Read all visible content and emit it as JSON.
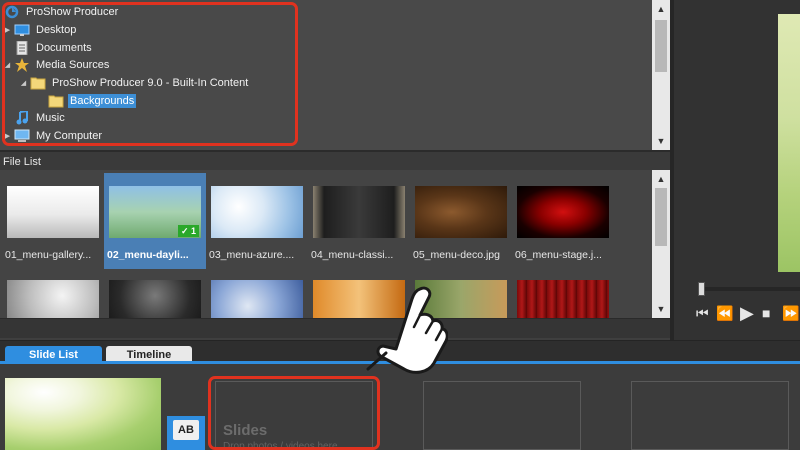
{
  "tree": {
    "items": [
      {
        "label": "ProShow Producer",
        "icon": "proshow-logo-icon"
      },
      {
        "label": "Desktop",
        "icon": "desktop-icon"
      },
      {
        "label": "Documents",
        "icon": "documents-icon"
      },
      {
        "label": "Media Sources",
        "icon": "star-icon"
      },
      {
        "label": "ProShow Producer 9.0 - Built-In Content",
        "icon": "folder-icon"
      },
      {
        "label": "Backgrounds",
        "icon": "folder-icon",
        "selected": true
      },
      {
        "label": "Music",
        "icon": "music-note-icon"
      },
      {
        "label": "My Computer",
        "icon": "computer-icon"
      }
    ]
  },
  "file_list": {
    "header": "File List",
    "files": [
      {
        "label": "01_menu-gallery...",
        "icon": "image-thumbnail-icon"
      },
      {
        "label": "02_menu-dayli...",
        "icon": "image-thumbnail-icon",
        "selected": true,
        "badge": "✓ 1"
      },
      {
        "label": "03_menu-azure....",
        "icon": "image-thumbnail-icon"
      },
      {
        "label": "04_menu-classi...",
        "icon": "image-thumbnail-icon"
      },
      {
        "label": "05_menu-deco.jpg",
        "icon": "image-thumbnail-icon"
      },
      {
        "label": "06_menu-stage.j...",
        "icon": "image-thumbnail-icon"
      }
    ]
  },
  "tabs": [
    {
      "label": "Slide List",
      "active": true
    },
    {
      "label": "Timeline",
      "active": false
    }
  ],
  "slide_list": {
    "transition_label": "AB",
    "placeholder_title": "Slides",
    "placeholder_hint": "Drop photos / videos here"
  },
  "player_controls": [
    "skip-back-icon",
    "rewind-icon",
    "play-icon",
    "stop-icon",
    "fast-forward-icon"
  ],
  "colors": {
    "accent": "#2f8ee0",
    "highlight": "#e0321f",
    "check_badge": "#2aa82a"
  }
}
